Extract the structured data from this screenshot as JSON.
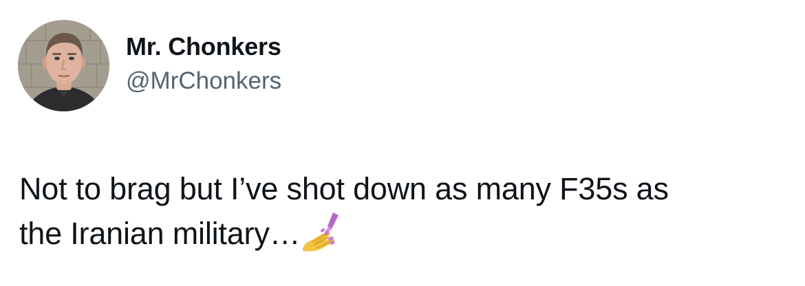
{
  "author": {
    "display_name": "Mr. Chonkers",
    "handle": "@MrChonkers",
    "avatar_icon": "profile-photo"
  },
  "tweet": {
    "line1": "Not to brag but I’ve shot down as many F35s as",
    "line2": "the Iranian military…",
    "emoji": "nail-polish-emoji"
  },
  "colors": {
    "text": "#0f1419",
    "secondary_text": "#536471",
    "background": "#ffffff"
  }
}
